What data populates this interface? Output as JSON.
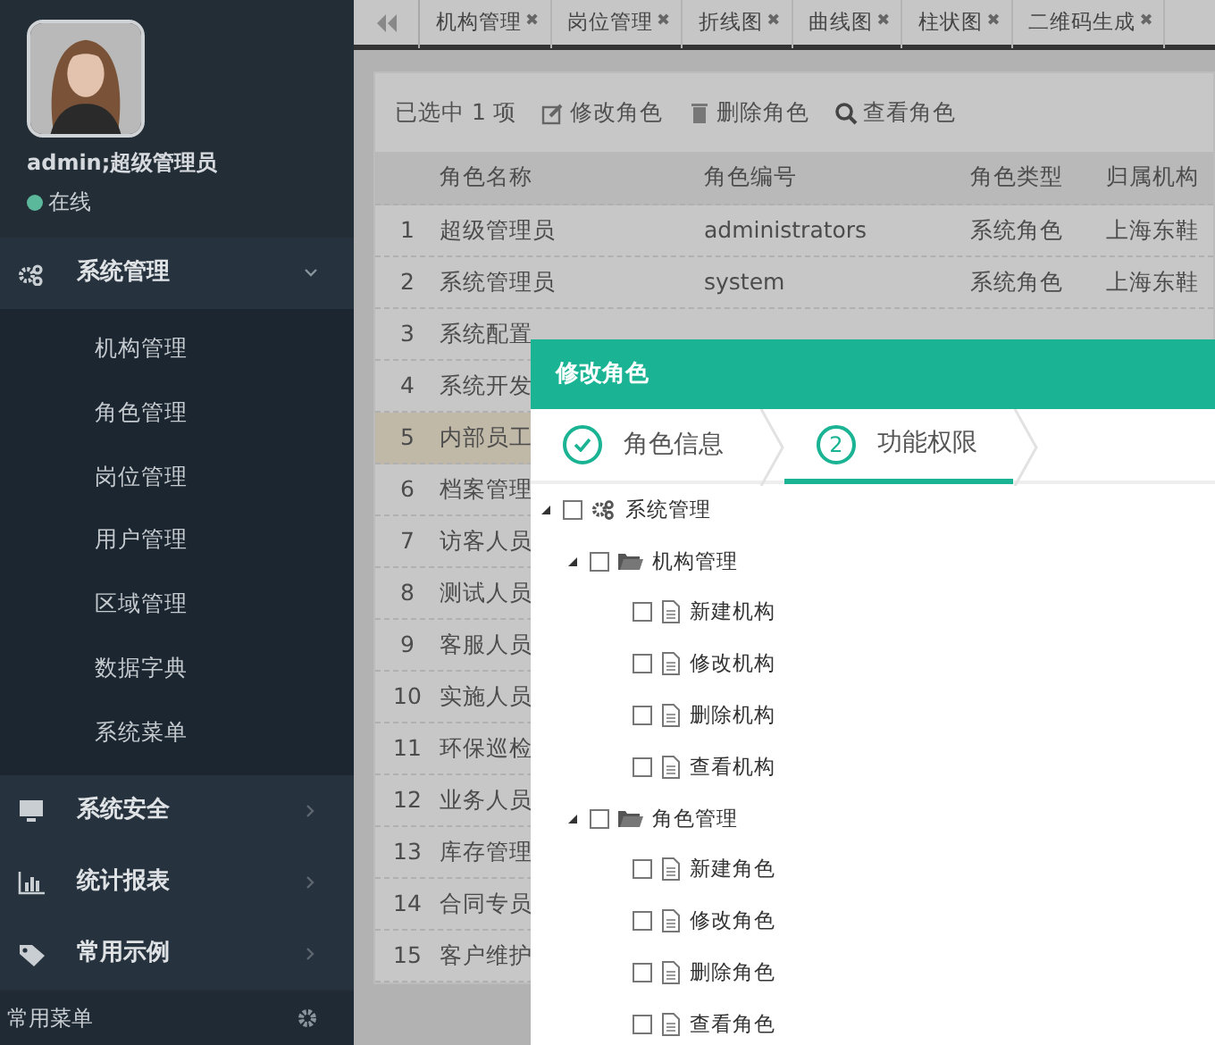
{
  "user": {
    "name": "admin;超级管理员",
    "status": "在线",
    "online": true
  },
  "menu": [
    {
      "label": "系统管理",
      "expanded": true,
      "children": [
        {
          "label": "机构管理"
        },
        {
          "label": "角色管理"
        },
        {
          "label": "岗位管理"
        },
        {
          "label": "用户管理"
        },
        {
          "label": "区域管理"
        },
        {
          "label": "数据字典"
        },
        {
          "label": "系统菜单"
        }
      ]
    },
    {
      "label": "系统安全",
      "expanded": false
    },
    {
      "label": "统计报表",
      "expanded": false
    },
    {
      "label": "常用示例",
      "expanded": false
    }
  ],
  "sidebar_footer": "常用菜单",
  "tabs": [
    {
      "label": "机构管理",
      "close": "✖"
    },
    {
      "label": "岗位管理",
      "close": "✖"
    },
    {
      "label": "折线图",
      "close": "✖"
    },
    {
      "label": "曲线图",
      "close": "✖"
    },
    {
      "label": "柱状图",
      "close": "✖"
    },
    {
      "label": "二维码生成",
      "close": "✖"
    }
  ],
  "toolbar": {
    "selection": "已选中 1 项",
    "actions": [
      {
        "label": "修改角色",
        "kind": "edit"
      },
      {
        "label": "删除角色",
        "kind": "delete"
      },
      {
        "label": "查看角色",
        "kind": "view"
      }
    ]
  },
  "table": {
    "columns": [
      "角色名称",
      "角色编号",
      "角色类型",
      "归属机构"
    ],
    "rows": [
      {
        "no": "1",
        "cells": [
          "超级管理员",
          "administrators",
          "系统角色",
          "上海东鞋"
        ],
        "selected": false
      },
      {
        "no": "2",
        "cells": [
          "系统管理员",
          "system",
          "系统角色",
          "上海东鞋"
        ],
        "selected": false
      },
      {
        "no": "3",
        "cells": [
          "系统配置"
        ],
        "selected": false
      },
      {
        "no": "4",
        "cells": [
          "系统开发"
        ],
        "selected": false
      },
      {
        "no": "5",
        "cells": [
          "内部员工"
        ],
        "selected": true
      },
      {
        "no": "6",
        "cells": [
          "档案管理"
        ],
        "selected": false
      },
      {
        "no": "7",
        "cells": [
          "访客人员"
        ],
        "selected": false
      },
      {
        "no": "8",
        "cells": [
          "测试人员"
        ],
        "selected": false
      },
      {
        "no": "9",
        "cells": [
          "客服人员"
        ],
        "selected": false
      },
      {
        "no": "10",
        "cells": [
          "实施人员"
        ],
        "selected": false
      },
      {
        "no": "11",
        "cells": [
          "环保巡检"
        ],
        "selected": false
      },
      {
        "no": "12",
        "cells": [
          "业务人员"
        ],
        "selected": false
      },
      {
        "no": "13",
        "cells": [
          "库存管理"
        ],
        "selected": false
      },
      {
        "no": "14",
        "cells": [
          "合同专员"
        ],
        "selected": false
      },
      {
        "no": "15",
        "cells": [
          "客户维护"
        ],
        "selected": false
      }
    ]
  },
  "dialog": {
    "title": "修改角色",
    "steps": [
      {
        "label": "角色信息",
        "done": true,
        "selected": false
      },
      {
        "number": "2",
        "label": "功能权限",
        "done": false,
        "selected": true
      }
    ],
    "tree": [
      {
        "label": "系统管理",
        "kind": "module",
        "checked": false,
        "expanded": true,
        "children": [
          {
            "label": "机构管理",
            "kind": "group",
            "checked": false,
            "expanded": true,
            "children": [
              {
                "label": "新建机构",
                "kind": "action",
                "checked": false
              },
              {
                "label": "修改机构",
                "kind": "action",
                "checked": false
              },
              {
                "label": "删除机构",
                "kind": "action",
                "checked": false
              },
              {
                "label": "查看机构",
                "kind": "action",
                "checked": false
              }
            ]
          },
          {
            "label": "角色管理",
            "kind": "group",
            "checked": false,
            "expanded": true,
            "children": [
              {
                "label": "新建角色",
                "kind": "action",
                "checked": false
              },
              {
                "label": "修改角色",
                "kind": "action",
                "checked": false
              },
              {
                "label": "删除角色",
                "kind": "action",
                "checked": false
              },
              {
                "label": "查看角色",
                "kind": "action",
                "checked": false
              }
            ]
          }
        ]
      }
    ]
  }
}
